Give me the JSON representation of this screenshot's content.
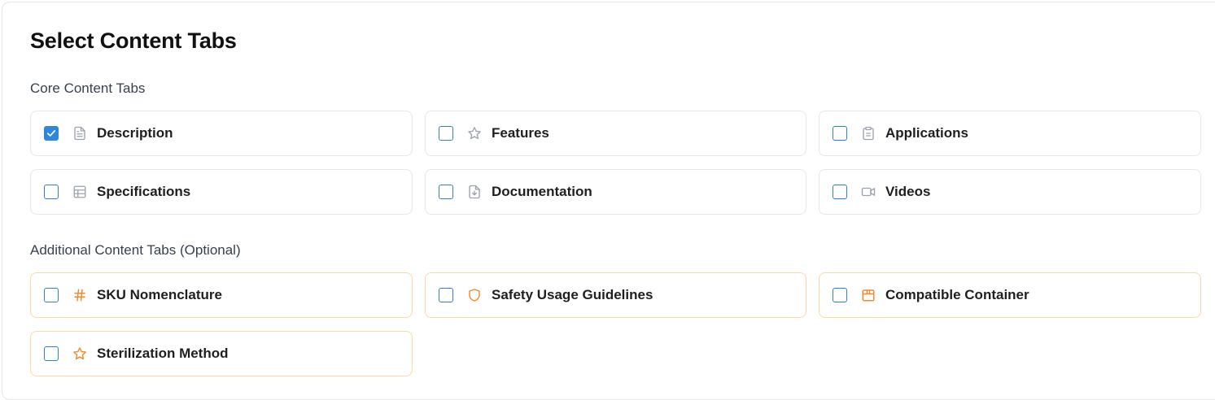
{
  "page": {
    "title": "Select Content Tabs"
  },
  "core": {
    "heading": "Core Content Tabs",
    "items": [
      {
        "label": "Description",
        "icon": "document-icon",
        "checked": true
      },
      {
        "label": "Features",
        "icon": "star-icon",
        "checked": false
      },
      {
        "label": "Applications",
        "icon": "clipboard-icon",
        "checked": false
      },
      {
        "label": "Specifications",
        "icon": "table-icon",
        "checked": false
      },
      {
        "label": "Documentation",
        "icon": "file-download-icon",
        "checked": false
      },
      {
        "label": "Videos",
        "icon": "video-camera-icon",
        "checked": false
      }
    ]
  },
  "additional": {
    "heading": "Additional Content Tabs (Optional)",
    "items": [
      {
        "label": "SKU Nomenclature",
        "icon": "hash-icon",
        "checked": false
      },
      {
        "label": "Safety Usage Guidelines",
        "icon": "shield-icon",
        "checked": false
      },
      {
        "label": "Compatible Container",
        "icon": "package-icon",
        "checked": false
      },
      {
        "label": "Sterilization Method",
        "icon": "star-icon",
        "checked": false
      }
    ]
  },
  "colors": {
    "checkbox_checked": "#2f86dd",
    "core_icon": "#9ca3af",
    "optional_icon": "#f08a2c",
    "optional_border": "#fcd9a8"
  }
}
